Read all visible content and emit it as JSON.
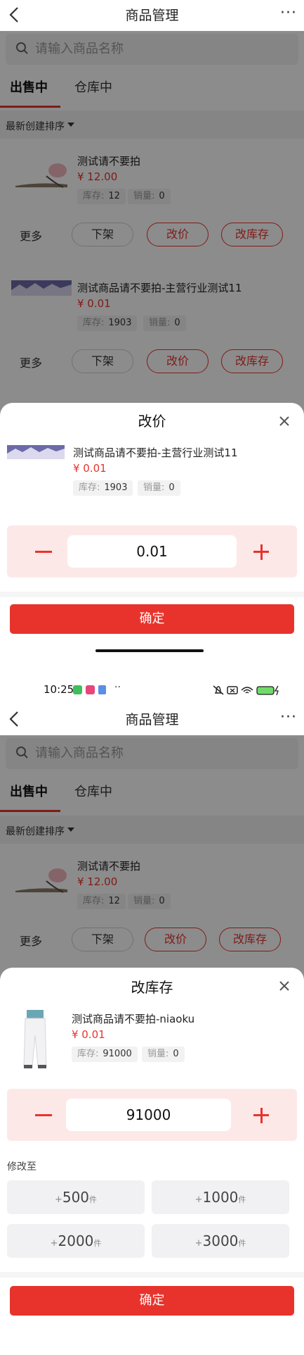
{
  "screen1": {
    "nav": {
      "title": "商品管理",
      "more": "···"
    },
    "search": {
      "placeholder": "请输入商品名称"
    },
    "tabs": [
      {
        "label": "出售中"
      },
      {
        "label": "仓库中"
      }
    ],
    "sort": {
      "label": "最新创建排序"
    },
    "products": [
      {
        "name": "测试请不要拍",
        "price": "¥ 12.00",
        "stock_label": "库存:",
        "stock": "12",
        "sales_label": "销量:",
        "sales": "0",
        "actions": {
          "more": "更多",
          "offshelf": "下架",
          "edit_price": "改价",
          "edit_stock": "改库存"
        }
      },
      {
        "name": "测试商品请不要拍-主营行业测试11",
        "price": "¥ 0.01",
        "stock_label": "库存:",
        "stock": "1903",
        "sales_label": "销量:",
        "sales": "0",
        "actions": {
          "more": "更多",
          "offshelf": "下架",
          "edit_price": "改价",
          "edit_stock": "改库存"
        }
      }
    ],
    "sheet": {
      "title": "改价",
      "product": {
        "name": "测试商品请不要拍-主营行业测试11",
        "price": "¥ 0.01",
        "stock_label": "库存:",
        "stock": "1903",
        "sales_label": "销量:",
        "sales": "0"
      },
      "value": "0.01",
      "confirm": "确定"
    }
  },
  "screen2": {
    "status": {
      "time": "10:25"
    },
    "nav": {
      "title": "商品管理",
      "more": "···"
    },
    "search": {
      "placeholder": "请输入商品名称"
    },
    "tabs": [
      {
        "label": "出售中"
      },
      {
        "label": "仓库中"
      }
    ],
    "sort": {
      "label": "最新创建排序"
    },
    "products": [
      {
        "name": "测试请不要拍",
        "price": "¥ 12.00",
        "stock_label": "库存:",
        "stock": "12",
        "sales_label": "销量:",
        "sales": "0",
        "actions": {
          "more": "更多",
          "offshelf": "下架",
          "edit_price": "改价",
          "edit_stock": "改库存"
        }
      }
    ],
    "sheet": {
      "title": "改库存",
      "product": {
        "name": "测试商品请不要拍-niaoku",
        "price": "¥ 0.01",
        "stock_label": "库存:",
        "stock": "91000",
        "sales_label": "销量:",
        "sales": "0"
      },
      "value": "91000",
      "modify_label": "修改至",
      "presets": [
        {
          "plus": "+",
          "amount": "500",
          "unit": "件"
        },
        {
          "plus": "+",
          "amount": "1000",
          "unit": "件"
        },
        {
          "plus": "+",
          "amount": "2000",
          "unit": "件"
        },
        {
          "plus": "+",
          "amount": "3000",
          "unit": "件"
        }
      ],
      "confirm": "确定"
    }
  },
  "colors": {
    "accent": "#e8332d",
    "stepper_bg": "#fde8e8",
    "chip_bg": "#f2f2f2"
  }
}
